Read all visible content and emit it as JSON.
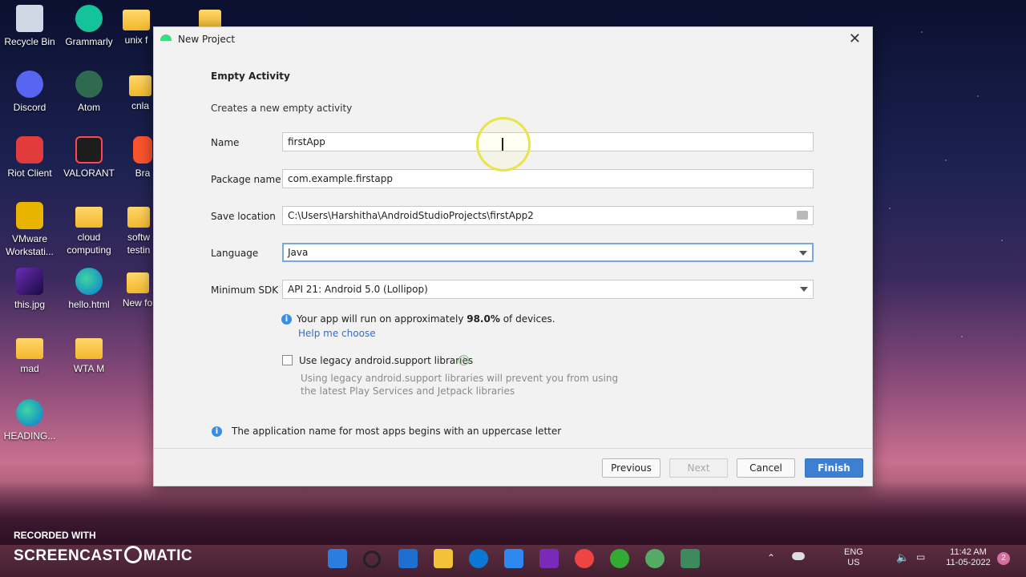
{
  "desktop": {
    "icons": [
      {
        "label": "Recycle Bin"
      },
      {
        "label": "Grammarly"
      },
      {
        "label": "unix f"
      },
      {
        "label": "Discord"
      },
      {
        "label": "Atom"
      },
      {
        "label": "cnla"
      },
      {
        "label": "Riot Client"
      },
      {
        "label": "VALORANT"
      },
      {
        "label": "Bra"
      },
      {
        "label": "VMware Workstati..."
      },
      {
        "label": "cloud computing"
      },
      {
        "label": "softw testin"
      },
      {
        "label": "this.jpg"
      },
      {
        "label": "hello.html"
      },
      {
        "label": "New fo"
      },
      {
        "label": "mad"
      },
      {
        "label": "WTA M"
      },
      {
        "label": "HEADING..."
      }
    ]
  },
  "dialog": {
    "title": "New Project",
    "heading": "Empty Activity",
    "description": "Creates a new empty activity",
    "fields": {
      "name": {
        "label": "Name",
        "value": "firstApp"
      },
      "package": {
        "label": "Package name",
        "value": "com.example.firstapp"
      },
      "save_location": {
        "label": "Save location",
        "value": "C:\\Users\\Harshitha\\AndroidStudioProjects\\firstApp2"
      },
      "language": {
        "label": "Language",
        "value": "Java"
      },
      "min_sdk": {
        "label": "Minimum SDK",
        "value": "API 21: Android 5.0 (Lollipop)"
      }
    },
    "sdk_info": {
      "prefix": "Your app will run on approximately ",
      "percent": "98.0%",
      "suffix": " of devices."
    },
    "help_link": "Help me choose",
    "legacy": {
      "label": "Use legacy android.support libraries",
      "checked": false,
      "note_line1": "Using legacy android.support libraries will prevent you from using",
      "note_line2": "the latest Play Services and Jetpack libraries"
    },
    "bottom_info": "The application name for most apps begins with an uppercase letter",
    "buttons": {
      "previous": "Previous",
      "next": "Next",
      "cancel": "Cancel",
      "finish": "Finish"
    }
  },
  "watermark": {
    "line1": "RECORDED WITH",
    "brand_left": "SCREENCAST",
    "brand_right": "MATIC"
  },
  "taskbar": {
    "language": "ENG",
    "region": "US",
    "time": "11:42 AM",
    "date": "11-05-2022",
    "notification_count": "2"
  }
}
